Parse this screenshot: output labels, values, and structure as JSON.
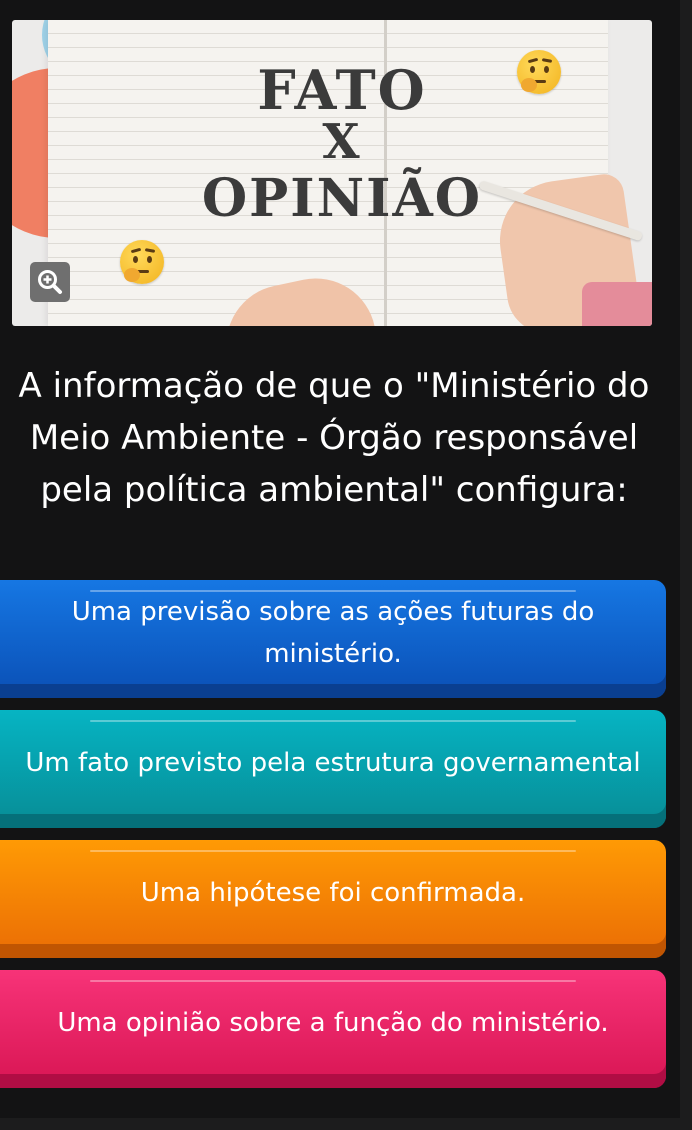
{
  "hero": {
    "line1": "FATO",
    "line2": "X",
    "line3": "OPINIÃO",
    "zoom_icon": "zoom-in-icon",
    "emoji": "thinking-face-icon"
  },
  "question": {
    "text": "A informação de que o \"Ministério do Meio Ambiente - Órgão responsável pela política ambiental\" configura:"
  },
  "answers": [
    {
      "text": "Uma previsão sobre as ações futuras do ministério.",
      "color": "#1677e3"
    },
    {
      "text": "Um fato previsto pela estrutura governamental",
      "color": "#06b4c3"
    },
    {
      "text": "Uma hipótese foi confirmada.",
      "color": "#ff9a05"
    },
    {
      "text": "Uma opinião sobre a função do ministério.",
      "color": "#f73378"
    }
  ]
}
